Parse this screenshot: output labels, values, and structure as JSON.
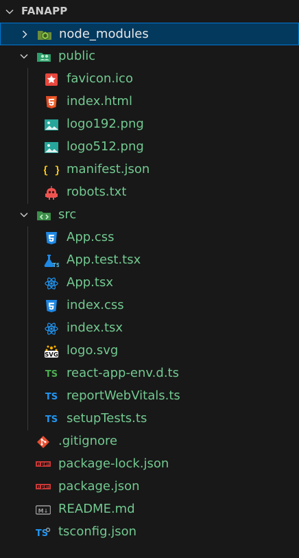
{
  "explorer": {
    "title": "FANAPP"
  },
  "items": {
    "node_modules": "node_modules",
    "public": "public",
    "favicon": "favicon.ico",
    "index_html": "index.html",
    "logo192": "logo192.png",
    "logo512": "logo512.png",
    "manifest": "manifest.json",
    "robots": "robots.txt",
    "src": "src",
    "app_css": "App.css",
    "app_test": "App.test.tsx",
    "app_tsx": "App.tsx",
    "index_css": "index.css",
    "index_tsx": "index.tsx",
    "logo_svg": "logo.svg",
    "react_env": "react-app-env.d.ts",
    "report": "reportWebVitals.ts",
    "setup": "setupTests.ts",
    "gitignore": ".gitignore",
    "pkg_lock": "package-lock.json",
    "pkg": "package.json",
    "readme": "README.md",
    "tsconfig": "tsconfig.json"
  },
  "icons": {
    "ts_badge": "TS",
    "svg_badge": "SVG",
    "md_badge": "M↓"
  },
  "colors": {
    "selected_bg": "#04395e",
    "selected_border": "#0078d4",
    "git_added": "#73c991"
  }
}
